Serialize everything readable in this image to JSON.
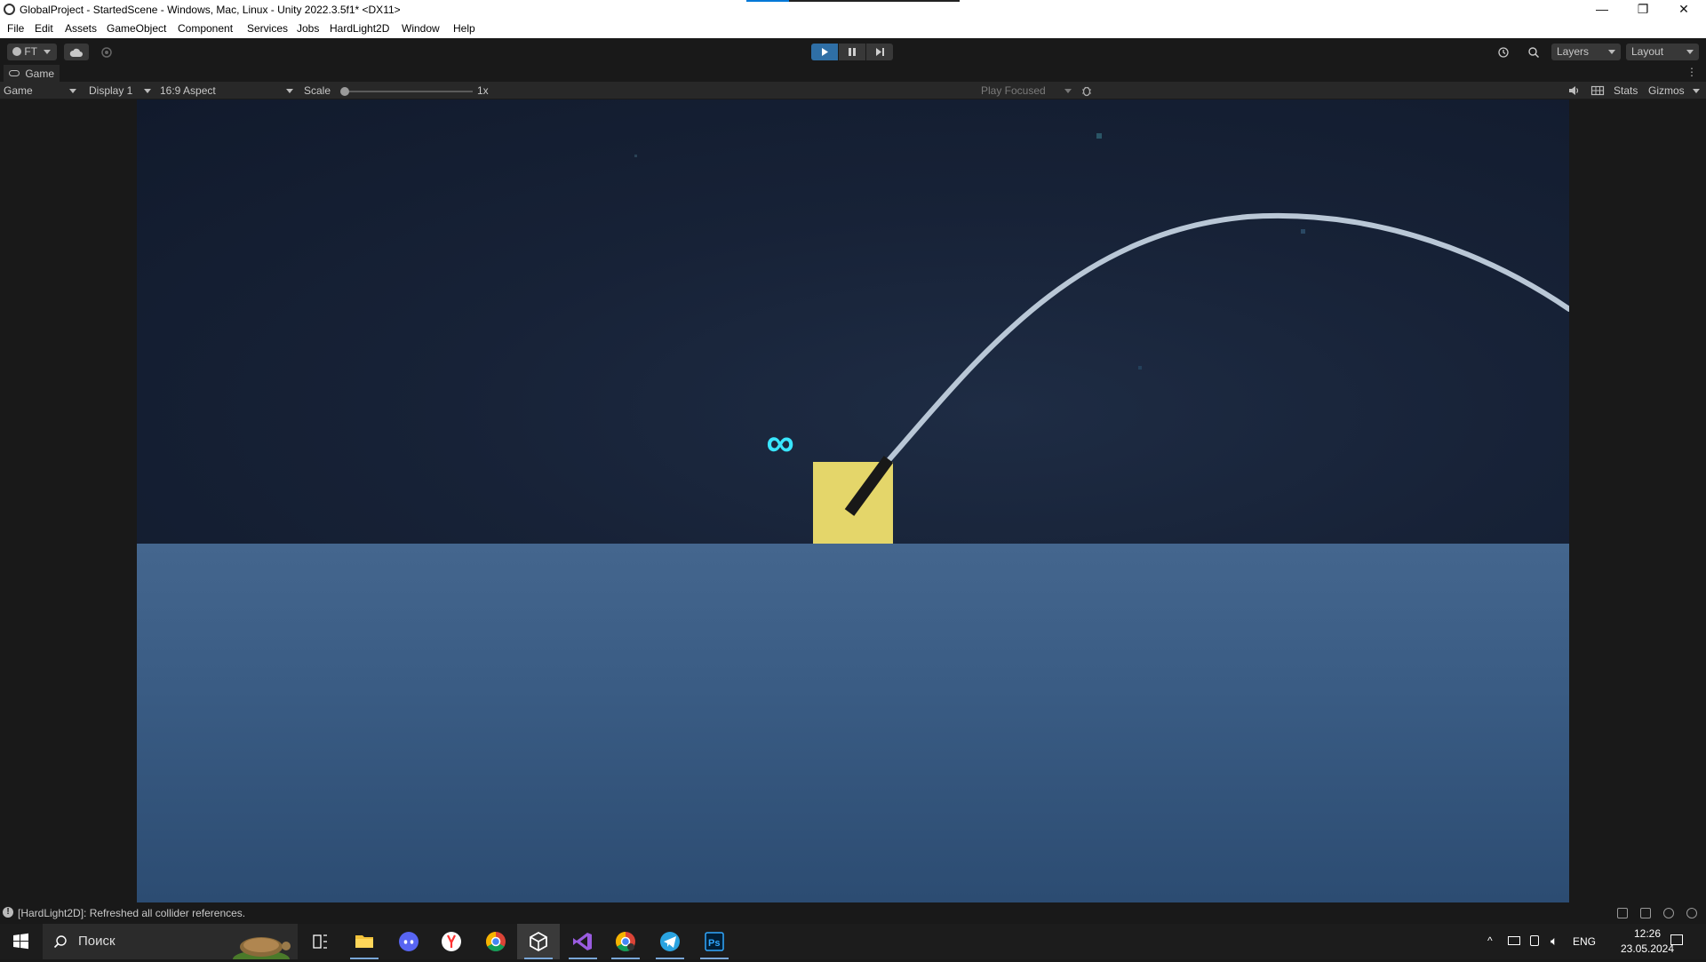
{
  "window": {
    "title": "GlobalProject - StartedScene - Windows, Mac, Linux - Unity 2022.3.5f1* <DX11>",
    "minimize": "—",
    "maximize": "❐",
    "close": "✕"
  },
  "menu": [
    "File",
    "Edit",
    "Assets",
    "GameObject",
    "Component",
    "Services",
    "Jobs",
    "HardLight2D",
    "Window",
    "Help"
  ],
  "toolbar": {
    "account_label": "FT",
    "layers_label": "Layers",
    "layout_label": "Layout",
    "play_active": true
  },
  "game_view": {
    "tab_label": "Game",
    "mode": "Game",
    "display": "Display 1",
    "aspect": "16:9 Aspect",
    "scale_label": "Scale",
    "scale_value": "1x",
    "play_focused": "Play Focused",
    "stats": "Stats",
    "gizmos": "Gizmos"
  },
  "scene": {
    "ammo_text": "∞",
    "colors": {
      "sky": "#172237",
      "ground": "#3a5c84",
      "player": "#e5d86a",
      "barrel": "#1a1a1a",
      "trajectory": "#b8c8d8",
      "ammo": "#39e6ff"
    }
  },
  "status": {
    "message": "[HardLight2D]: Refreshed all collider references."
  },
  "taskbar": {
    "search_placeholder": "Поиск",
    "lang": "ENG",
    "time": "12:26",
    "date": "23.05.2024"
  }
}
